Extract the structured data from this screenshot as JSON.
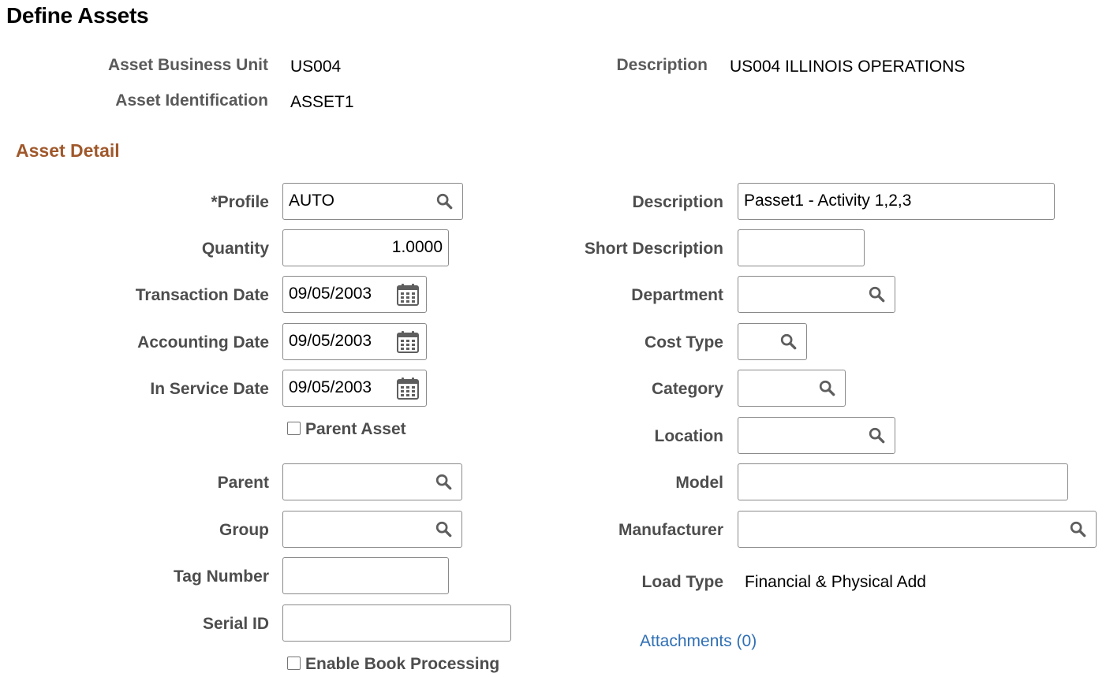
{
  "page": {
    "title": "Define Assets"
  },
  "header": {
    "business_unit_label": "Asset Business Unit",
    "business_unit_value": "US004",
    "description_label": "Description",
    "description_value": "US004 ILLINOIS OPERATIONS",
    "asset_id_label": "Asset Identification",
    "asset_id_value": "ASSET1"
  },
  "section": {
    "title": "Asset Detail"
  },
  "left": {
    "profile": {
      "label": "*Profile",
      "value": "AUTO",
      "icon": "search-icon"
    },
    "quantity": {
      "label": "Quantity",
      "value": "1.0000"
    },
    "transaction_date": {
      "label": "Transaction Date",
      "value": "09/05/2003",
      "icon": "calendar-icon"
    },
    "accounting_date": {
      "label": "Accounting Date",
      "value": "09/05/2003",
      "icon": "calendar-icon"
    },
    "in_service_date": {
      "label": "In Service Date",
      "value": "09/05/2003",
      "icon": "calendar-icon"
    },
    "parent_asset": {
      "label": "Parent Asset",
      "checked": false
    },
    "parent": {
      "label": "Parent",
      "value": "",
      "icon": "search-icon"
    },
    "group": {
      "label": "Group",
      "value": "",
      "icon": "search-icon"
    },
    "tag_number": {
      "label": "Tag Number",
      "value": ""
    },
    "serial_id": {
      "label": "Serial ID",
      "value": ""
    },
    "enable_book_processing": {
      "label": "Enable Book Processing",
      "checked": false
    }
  },
  "right": {
    "description": {
      "label": "Description",
      "value": "Passet1 - Activity 1,2,3"
    },
    "short_description": {
      "label": "Short Description",
      "value": ""
    },
    "department": {
      "label": "Department",
      "value": "",
      "icon": "search-icon"
    },
    "cost_type": {
      "label": "Cost Type",
      "value": "",
      "icon": "search-icon"
    },
    "category": {
      "label": "Category",
      "value": "",
      "icon": "search-icon"
    },
    "location": {
      "label": "Location",
      "value": "",
      "icon": "search-icon"
    },
    "model": {
      "label": "Model",
      "value": ""
    },
    "manufacturer": {
      "label": "Manufacturer",
      "value": "",
      "icon": "search-icon"
    },
    "load_type": {
      "label": "Load Type",
      "value": "Financial & Physical Add"
    },
    "attachments": {
      "label": "Attachments (0)"
    }
  },
  "colors": {
    "section_title": "#a0582b",
    "link": "#2f6fb4",
    "label": "#4d4d4d"
  }
}
